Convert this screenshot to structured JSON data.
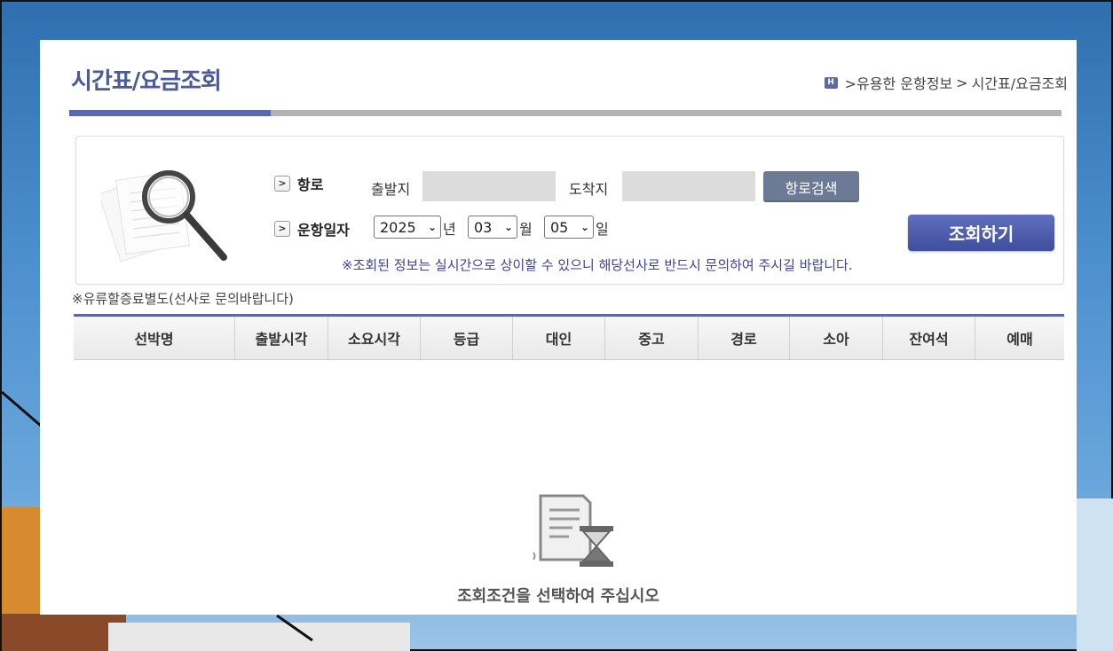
{
  "header": {
    "title": "시간표/요금조회",
    "breadcrumb": [
      ">유용한 운항정보",
      ">",
      "시간표/요금조회"
    ]
  },
  "search": {
    "route_label": "항로",
    "departure_label": "출발지",
    "arrival_label": "도착지",
    "route_search_button": "항로검색",
    "date_label": "운항일자",
    "year": "2025",
    "year_unit": "년",
    "month": "03",
    "month_unit": "월",
    "day": "05",
    "day_unit": "일",
    "submit_button": "조회하기",
    "notice": "※조회된 정보는 실시간으로 상이할 수 있으니 해당선사로 반드시 문의하여 주시길 바랍니다."
  },
  "surcharge_note": "※유류할증료별도(선사로 문의바랍니다)",
  "table": {
    "columns": [
      "선박명",
      "출발시각",
      "소요시각",
      "등급",
      "대인",
      "중고",
      "경로",
      "소아",
      "잔여석",
      "예매"
    ]
  },
  "empty_message": "조회조건을 선택하여 주십시오",
  "colors": {
    "accent": "#5c68ad",
    "notice_text": "#3b3fa8",
    "submit_button": "#4a59a8"
  }
}
